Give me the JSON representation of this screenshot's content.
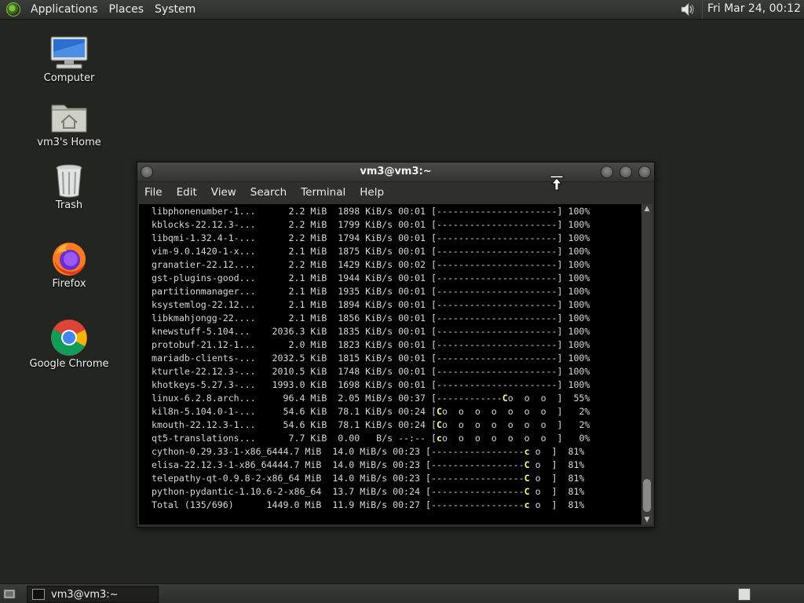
{
  "top_panel": {
    "menus": [
      "Applications",
      "Places",
      "System"
    ],
    "clock": "Fri Mar 24, 00:12"
  },
  "desktop_icons": [
    {
      "label": "Computer",
      "icon": "computer-icon"
    },
    {
      "label": "vm3's Home",
      "icon": "home-folder-icon"
    },
    {
      "label": "Trash",
      "icon": "trash-icon"
    },
    {
      "label": "Firefox",
      "icon": "firefox-icon"
    },
    {
      "label": "Google Chrome",
      "icon": "chrome-icon"
    }
  ],
  "terminal": {
    "title": "vm3@vm3:~",
    "menus": [
      "File",
      "Edit",
      "View",
      "Search",
      "Terminal",
      "Help"
    ],
    "lines": [
      {
        "pre": " libphonenumber-1...      2.2 MiB  1898 KiB/s 00:01 [----------------------] 100%",
        "pac": "",
        "post": ""
      },
      {
        "pre": " kblocks-22.12.3-...      2.2 MiB  1799 KiB/s 00:01 [----------------------] 100%",
        "pac": "",
        "post": ""
      },
      {
        "pre": " libqmi-1.32.4-1-...      2.2 MiB  1794 KiB/s 00:01 [----------------------] 100%",
        "pac": "",
        "post": ""
      },
      {
        "pre": " vim-9.0.1420-1-x...      2.1 MiB  1875 KiB/s 00:01 [----------------------] 100%",
        "pac": "",
        "post": ""
      },
      {
        "pre": " granatier-22.12....      2.2 MiB  1429 KiB/s 00:02 [----------------------] 100%",
        "pac": "",
        "post": ""
      },
      {
        "pre": " gst-plugins-good...      2.1 MiB  1944 KiB/s 00:01 [----------------------] 100%",
        "pac": "",
        "post": ""
      },
      {
        "pre": " partitionmanager...      2.1 MiB  1935 KiB/s 00:01 [----------------------] 100%",
        "pac": "",
        "post": ""
      },
      {
        "pre": " ksystemlog-22.12...      2.1 MiB  1894 KiB/s 00:01 [----------------------] 100%",
        "pac": "",
        "post": ""
      },
      {
        "pre": " libkmahjongg-22....      2.1 MiB  1856 KiB/s 00:01 [----------------------] 100%",
        "pac": "",
        "post": ""
      },
      {
        "pre": " knewstuff-5.104...    2036.3 KiB  1835 KiB/s 00:01 [----------------------] 100%",
        "pac": "",
        "post": ""
      },
      {
        "pre": " protobuf-21.12-1...      2.0 MiB  1823 KiB/s 00:01 [----------------------] 100%",
        "pac": "",
        "post": ""
      },
      {
        "pre": " mariadb-clients-...   2032.5 KiB  1815 KiB/s 00:01 [----------------------] 100%",
        "pac": "",
        "post": ""
      },
      {
        "pre": " kturtle-22.12.3-...   2010.5 KiB  1748 KiB/s 00:01 [----------------------] 100%",
        "pac": "",
        "post": ""
      },
      {
        "pre": " khotkeys-5.27.3-...   1993.0 KiB  1698 KiB/s 00:01 [----------------------] 100%",
        "pac": "",
        "post": ""
      },
      {
        "pre": " linux-6.2.8.arch...     96.4 MiB  2.05 MiB/s 00:37 [------------",
        "pac": "C",
        "post": "o  o  o  ]  55%"
      },
      {
        "pre": " kil8n-5.104.0-1-...     54.6 KiB  78.1 KiB/s 00:24 [",
        "pac": "C",
        "post": "o  o  o  o  o  o  o  ]   2%"
      },
      {
        "pre": " kmouth-22.12.3-1...     54.6 KiB  78.1 KiB/s 00:24 [",
        "pac": "C",
        "post": "o  o  o  o  o  o  o  ]   2%"
      },
      {
        "pre": " qt5-translations...      7.7 KiB  0.00   B/s --:-- [",
        "pac": "c",
        "post": "o  o  o  o  o  o  o  ]   0%"
      },
      {
        "pre": " cython-0.29.33-1-x86_6444.7 MiB  14.0 MiB/s 00:23 [-----------------",
        "pac": "c",
        "post": " o  ]  81%"
      },
      {
        "pre": " elisa-22.12.3-1-x86_64444.7 MiB  14.0 MiB/s 00:23 [-----------------",
        "pac": "C",
        "post": " o  ]  81%"
      },
      {
        "pre": " telepathy-qt-0.9.8-2-x86_64 MiB  14.0 MiB/s 00:23 [-----------------",
        "pac": "C",
        "post": " o  ]  81%"
      },
      {
        "pre": " python-pydantic-1.10.6-2-x86_64  13.7 MiB/s 00:24 [-----------------",
        "pac": "C",
        "post": " o  ]  81%"
      },
      {
        "pre": " Total (135/696)      1449.0 MiB  11.9 MiB/s 00:27 [-----------------",
        "pac": "c",
        "post": " o  ]  81%"
      }
    ]
  },
  "taskbar": {
    "window_button": "vm3@vm3:~"
  }
}
